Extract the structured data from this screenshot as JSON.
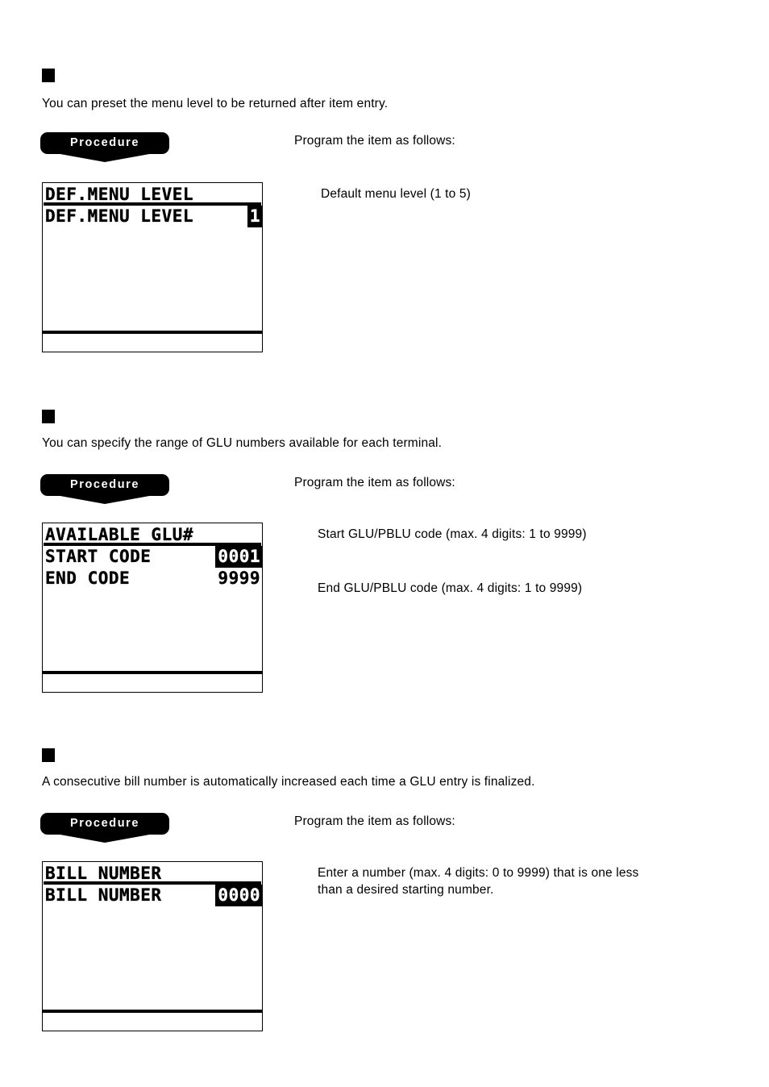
{
  "page": {
    "background": "#ffffff",
    "accent": "#000000"
  },
  "sections": [
    {
      "bullet": "filled-square",
      "intro": "You can preset the menu level to be returned after item entry.",
      "procedure_label": "Procedure",
      "procedure_note": "Program the item as follows:",
      "lcd": {
        "title": "DEF.MENU LEVEL",
        "rows": [
          {
            "label": "DEF.MENU LEVEL",
            "value": "1",
            "highlighted": true
          }
        ]
      },
      "descriptions": [
        "Default menu level (1 to 5)"
      ]
    },
    {
      "bullet": "filled-square",
      "intro": "You can specify the range of GLU numbers available for each terminal.",
      "procedure_label": "Procedure",
      "procedure_note": "Program the item as follows:",
      "lcd": {
        "title": "AVAILABLE GLU#",
        "rows": [
          {
            "label": "START CODE",
            "value": "0001",
            "highlighted": true
          },
          {
            "label": "END CODE",
            "value": "9999",
            "highlighted": false
          }
        ]
      },
      "descriptions": [
        "Start GLU/PBLU code (max. 4 digits: 1 to 9999)",
        "End GLU/PBLU code (max. 4 digits: 1 to 9999)"
      ]
    },
    {
      "bullet": "filled-square",
      "intro": "A consecutive bill number is automatically increased each time a GLU entry is finalized.",
      "procedure_label": "Procedure",
      "procedure_note": "Program the item as follows:",
      "lcd": {
        "title": "BILL NUMBER",
        "rows": [
          {
            "label": "BILL NUMBER",
            "value": "0000",
            "highlighted": true
          }
        ]
      },
      "descriptions": [
        "Enter a number (max. 4 digits: 0 to 9999) that is one less than a desired starting number."
      ]
    }
  ]
}
